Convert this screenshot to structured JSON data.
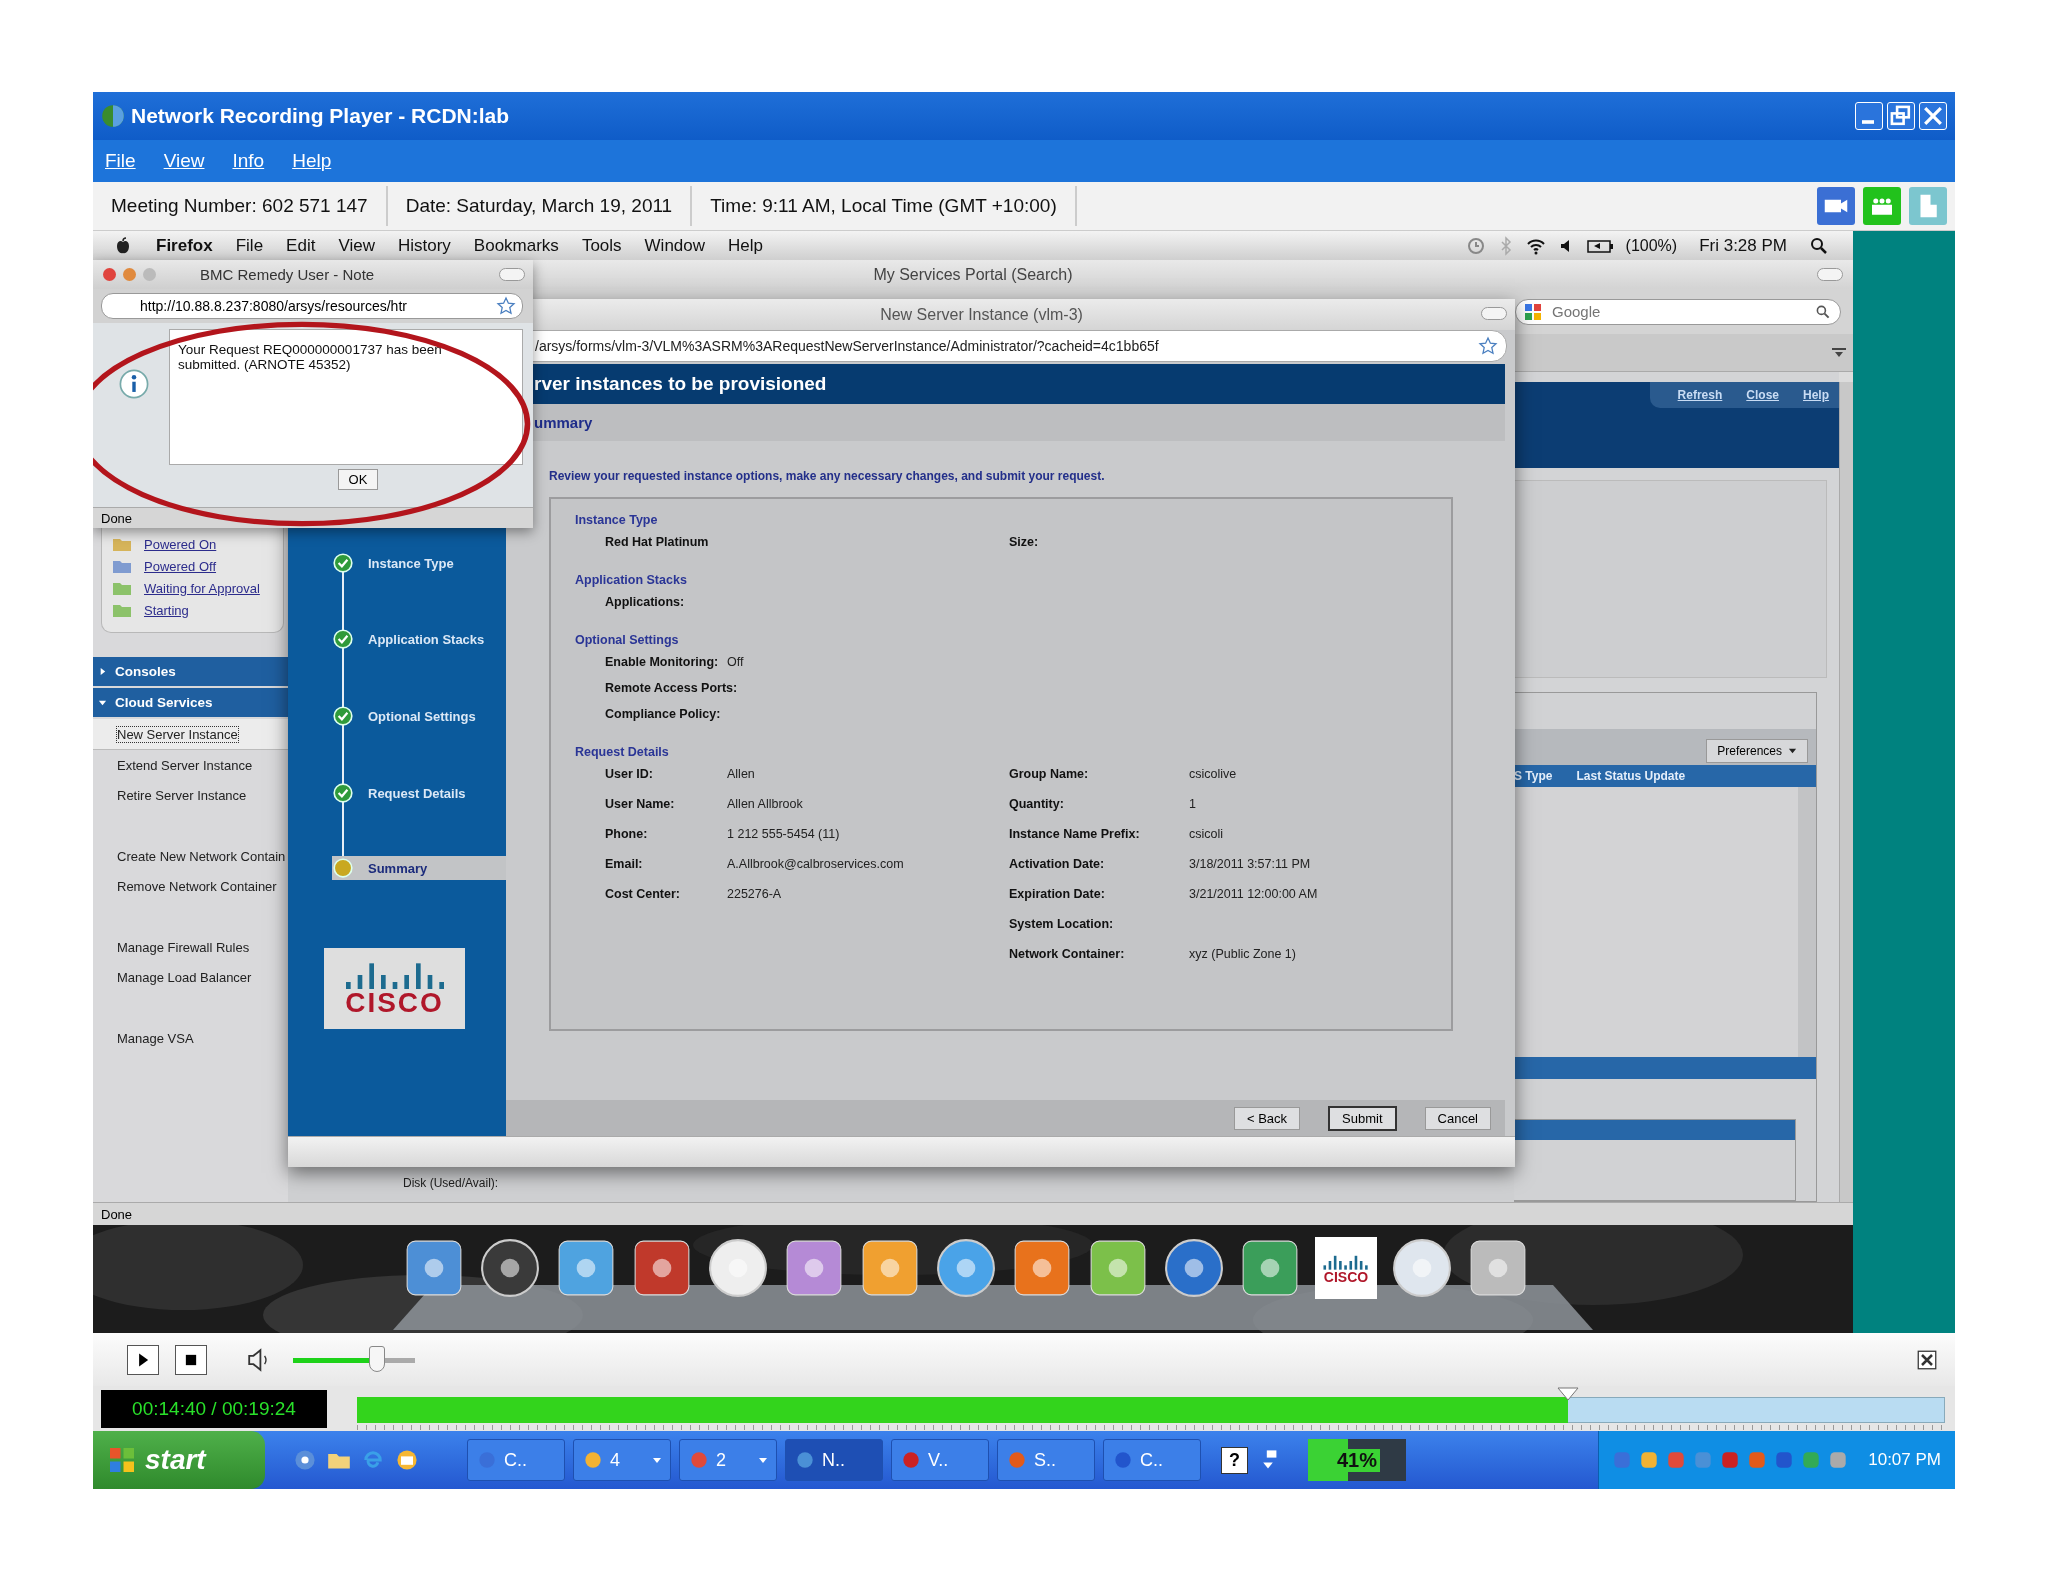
{
  "window": {
    "title": "Network Recording Player - RCDN:lab"
  },
  "menu": [
    "File",
    "View",
    "Info",
    "Help"
  ],
  "info_bar": [
    "Meeting Number: 602 571 147",
    "Date: Saturday, March 19, 2011",
    "Time: 9:11 AM, Local Time (GMT +10:00)"
  ],
  "mac_menubar": {
    "app": "Firefox",
    "items": [
      "File",
      "Edit",
      "View",
      "History",
      "Bookmarks",
      "Tools",
      "Window",
      "Help"
    ],
    "battery": "(100%)",
    "clock": "Fri 3:28 PM"
  },
  "portal_window": {
    "title": "My Services Portal (Search)",
    "search": {
      "placeholder": "Google"
    },
    "links": [
      "Refresh",
      "Close",
      "Help"
    ],
    "folders": [
      {
        "label": "Powered On",
        "color": "#d6b45a"
      },
      {
        "label": "Powered Off",
        "color": "#7f9bd0"
      },
      {
        "label": "Waiting for Approval",
        "color": "#8cc26a"
      },
      {
        "label": "Starting",
        "color": "#8cc26a"
      }
    ],
    "sections": [
      {
        "label": "Consoles",
        "expanded": false
      },
      {
        "label": "Cloud Services",
        "expanded": true,
        "groups": [
          [
            {
              "label": "New Server Instance",
              "selected": true
            },
            {
              "label": "Extend Server Instance",
              "selected": false
            },
            {
              "label": "Retire Server Instance",
              "selected": false
            }
          ],
          [
            {
              "label": "Create New Network Contain",
              "selected": false
            },
            {
              "label": "Remove Network Container",
              "selected": false
            }
          ],
          [
            {
              "label": "Manage Firewall Rules",
              "selected": false
            },
            {
              "label": "Manage Load Balancer",
              "selected": false
            }
          ],
          [
            {
              "label": "Manage VSA",
              "selected": false
            }
          ]
        ]
      }
    ],
    "preferences": "Preferences",
    "columns": [
      "S Type",
      "Last Status Update"
    ],
    "disk_label": "Disk (Used/Avail):",
    "status": "Done"
  },
  "form_window": {
    "title": "New Server Instance (vlm-3)",
    "url": "/arsys/forms/vlm-3/VLM%3ASRM%3ARequestNewServerInstance/Administrator/?cacheid=4c1bb65f",
    "heading": "rver instances to be provisioned",
    "subheading": "ummary",
    "steps": [
      {
        "label": "Instance Type",
        "done": true,
        "selected": false
      },
      {
        "label": "Application Stacks",
        "done": true,
        "selected": false
      },
      {
        "label": "Optional Settings",
        "done": true,
        "selected": false
      },
      {
        "label": "Request Details",
        "done": true,
        "selected": false
      },
      {
        "label": "Summary",
        "done": false,
        "selected": true
      }
    ],
    "logo_text": "CISCO",
    "instruction": "Review your requested instance options, make any necessary changes, and submit your request.",
    "sections": [
      {
        "title": "Instance Type",
        "rows": [
          {
            "label": "Red Hat Platinum",
            "value": "",
            "label2": "Size:",
            "value2": ""
          }
        ]
      },
      {
        "title": "Application Stacks",
        "rows": [
          {
            "label": "Applications:",
            "value": "",
            "label2": "",
            "value2": ""
          }
        ]
      },
      {
        "title": "Optional Settings",
        "rows": [
          {
            "label": "Enable Monitoring:",
            "value": "Off",
            "label2": "",
            "value2": ""
          },
          {
            "label": "Remote Access Ports:",
            "value": "",
            "label2": "",
            "value2": ""
          },
          {
            "label": "Compliance Policy:",
            "value": "",
            "label2": "",
            "value2": ""
          }
        ]
      },
      {
        "title": "Request Details",
        "rows": [
          {
            "label": "User ID:",
            "value": "Allen",
            "label2": "Group Name:",
            "value2": "csicolive"
          },
          {
            "label": "User Name:",
            "value": "Allen Allbrook",
            "label2": "Quantity:",
            "value2": "1"
          },
          {
            "label": "Phone:",
            "value": "1 212 555-5454 (11)",
            "label2": "Instance Name Prefix:",
            "value2": "csicoli"
          },
          {
            "label": "Email:",
            "value": "A.Allbrook@calbroservices.com",
            "label2": "Activation Date:",
            "value2": "3/18/2011 3:57:11 PM"
          },
          {
            "label": "Cost Center:",
            "value": "225276-A",
            "label2": "Expiration Date:",
            "value2": "3/21/2011 12:00:00 AM"
          },
          {
            "label": "",
            "value": "",
            "label2": "System Location:",
            "value2": ""
          },
          {
            "label": "",
            "value": "",
            "label2": "Network Container:",
            "value2": "xyz (Public Zone 1)"
          }
        ]
      }
    ],
    "buttons": [
      {
        "label": "< Back",
        "focused": false
      },
      {
        "label": "Submit",
        "focused": true
      },
      {
        "label": "Cancel",
        "focused": false
      }
    ]
  },
  "dialog": {
    "title": "BMC Remedy User - Note",
    "url": "http://10.88.8.237:8080/arsys/resources/htr",
    "message": "Your Request REQ000000001737 has been submitted. (ARNOTE 45352)",
    "button": "OK",
    "status": "Done"
  },
  "dock": {
    "logo_text": "CISCO"
  },
  "player": {
    "volume": {
      "level": 0.68
    },
    "time": "00:14:40 / 00:19:24",
    "progress": {
      "level": 0.757
    }
  },
  "taskbar": {
    "start": "start",
    "tasks": [
      {
        "label": "C..",
        "selected": false,
        "menu": false
      },
      {
        "label": "4",
        "selected": false,
        "menu": true
      },
      {
        "label": "2",
        "selected": false,
        "menu": true
      },
      {
        "label": "N..",
        "selected": true,
        "menu": false
      },
      {
        "label": "V..",
        "selected": false,
        "menu": false
      },
      {
        "label": "S..",
        "selected": false,
        "menu": false
      },
      {
        "label": "C..",
        "selected": false,
        "menu": false
      }
    ],
    "help": "?",
    "meter": {
      "label": "41%",
      "level": 0.41
    },
    "clock": "10:07 PM"
  }
}
